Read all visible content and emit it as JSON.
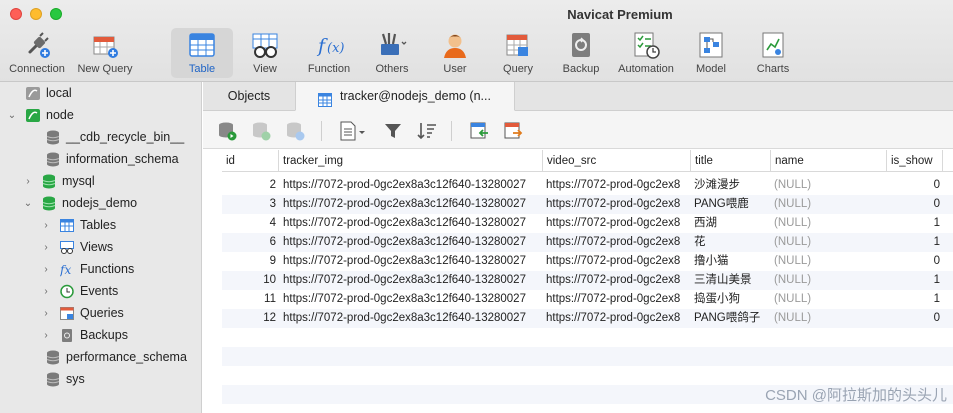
{
  "window": {
    "title": "Navicat Premium"
  },
  "toolbar": {
    "items": [
      {
        "label": "Connection",
        "icon": "plug-icon"
      },
      {
        "label": "New Query",
        "icon": "new-query-icon"
      },
      {
        "label": "Table",
        "icon": "table-icon",
        "active": true
      },
      {
        "label": "View",
        "icon": "view-icon"
      },
      {
        "label": "Function",
        "icon": "function-icon"
      },
      {
        "label": "Others",
        "icon": "tools-icon"
      },
      {
        "label": "User",
        "icon": "user-icon"
      },
      {
        "label": "Query",
        "icon": "query-icon"
      },
      {
        "label": "Backup",
        "icon": "backup-icon"
      },
      {
        "label": "Automation",
        "icon": "automation-icon"
      },
      {
        "label": "Model",
        "icon": "model-icon"
      },
      {
        "label": "Charts",
        "icon": "charts-icon"
      }
    ]
  },
  "sidebar": {
    "items": [
      {
        "label": "local",
        "type": "connection"
      },
      {
        "label": "node",
        "type": "connection"
      },
      {
        "label": "__cdb_recycle_bin__",
        "type": "database"
      },
      {
        "label": "information_schema",
        "type": "database"
      },
      {
        "label": "mysql",
        "type": "database"
      },
      {
        "label": "nodejs_demo",
        "type": "database"
      },
      {
        "label": "Tables",
        "type": "group"
      },
      {
        "label": "Views",
        "type": "group"
      },
      {
        "label": "Functions",
        "type": "group"
      },
      {
        "label": "Events",
        "type": "group"
      },
      {
        "label": "Queries",
        "type": "group"
      },
      {
        "label": "Backups",
        "type": "group"
      },
      {
        "label": "performance_schema",
        "type": "database"
      },
      {
        "label": "sys",
        "type": "database"
      }
    ]
  },
  "tabs": [
    {
      "label": "Objects"
    },
    {
      "label": "tracker@nodejs_demo (n..."
    }
  ],
  "grid": {
    "columns": [
      "id",
      "tracker_img",
      "video_src",
      "title",
      "name",
      "is_show"
    ],
    "rows": [
      {
        "id": "2",
        "tracker_img": "https://7072-prod-0gc2ex8a3c12f640-13280027",
        "video_src": "https://7072-prod-0gc2ex8",
        "title": "沙滩漫步",
        "name": "(NULL)",
        "is_show": "0"
      },
      {
        "id": "3",
        "tracker_img": "https://7072-prod-0gc2ex8a3c12f640-13280027",
        "video_src": "https://7072-prod-0gc2ex8",
        "title": "PANG喂鹿",
        "name": "(NULL)",
        "is_show": "0"
      },
      {
        "id": "4",
        "tracker_img": "https://7072-prod-0gc2ex8a3c12f640-13280027",
        "video_src": "https://7072-prod-0gc2ex8",
        "title": "西湖",
        "name": "(NULL)",
        "is_show": "1"
      },
      {
        "id": "6",
        "tracker_img": "https://7072-prod-0gc2ex8a3c12f640-13280027",
        "video_src": "https://7072-prod-0gc2ex8",
        "title": "花",
        "name": "(NULL)",
        "is_show": "1"
      },
      {
        "id": "9",
        "tracker_img": "https://7072-prod-0gc2ex8a3c12f640-13280027",
        "video_src": "https://7072-prod-0gc2ex8",
        "title": "撸小猫",
        "name": "(NULL)",
        "is_show": "0"
      },
      {
        "id": "10",
        "tracker_img": "https://7072-prod-0gc2ex8a3c12f640-13280027",
        "video_src": "https://7072-prod-0gc2ex8",
        "title": "三清山美景",
        "name": "(NULL)",
        "is_show": "1"
      },
      {
        "id": "11",
        "tracker_img": "https://7072-prod-0gc2ex8a3c12f640-13280027",
        "video_src": "https://7072-prod-0gc2ex8",
        "title": "捣蛋小狗",
        "name": "(NULL)",
        "is_show": "1"
      },
      {
        "id": "12",
        "tracker_img": "https://7072-prod-0gc2ex8a3c12f640-13280027",
        "video_src": "https://7072-prod-0gc2ex8",
        "title": "PANG喂鸽子",
        "name": "(NULL)",
        "is_show": "0"
      }
    ]
  },
  "watermark": "CSDN @阿拉斯加的头头儿",
  "colors": {
    "accent": "#1f64c6",
    "null_text": "#9a9a9a",
    "alt_row": "#f4f6fb"
  }
}
